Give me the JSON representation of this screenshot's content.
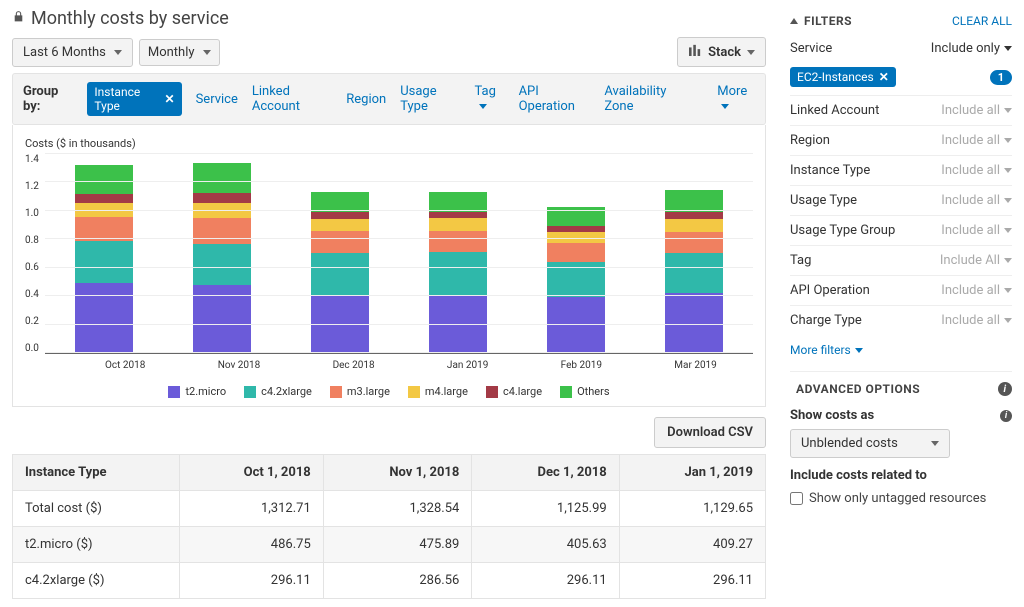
{
  "header": {
    "title": "Monthly costs by service"
  },
  "toolbar": {
    "range_label": "Last 6 Months",
    "granularity_label": "Monthly",
    "stack_label": "Stack"
  },
  "groupby": {
    "label": "Group by:",
    "chip": "Instance Type",
    "options": [
      "Service",
      "Linked Account",
      "Region",
      "Usage Type",
      "Tag",
      "API Operation",
      "Availability Zone",
      "More"
    ]
  },
  "chart_data": {
    "type": "bar",
    "title": "",
    "ylabel": "Costs ($ in thousands)",
    "ylim": [
      0,
      1.4
    ],
    "yticks": [
      "0.0",
      "0.2",
      "0.4",
      "0.6",
      "0.8",
      "1.0",
      "1.2",
      "1.4"
    ],
    "categories": [
      "Oct 2018",
      "Nov 2018",
      "Dec 2018",
      "Jan 2019",
      "Feb 2019",
      "Mar 2019"
    ],
    "series": [
      {
        "name": "t2.micro",
        "color": "#6b5bd9",
        "values": [
          486.75,
          475.89,
          405.63,
          409.27,
          390.0,
          420.0
        ]
      },
      {
        "name": "c4.2xlarge",
        "color": "#2fb8aa",
        "values": [
          296.11,
          286.56,
          296.11,
          296.11,
          250.0,
          280.0
        ]
      },
      {
        "name": "m3.large",
        "color": "#f08060",
        "values": [
          170.0,
          180.0,
          150.0,
          150.0,
          130.0,
          150.0
        ]
      },
      {
        "name": "m4.large",
        "color": "#f3c844",
        "values": [
          100.0,
          110.0,
          90.0,
          90.0,
          80.0,
          90.0
        ]
      },
      {
        "name": "c4.large",
        "color": "#a33a46",
        "values": [
          60.0,
          66.0,
          44.0,
          44.0,
          40.0,
          50.0
        ]
      },
      {
        "name": "Others",
        "color": "#3cc14a",
        "values": [
          200.0,
          210.0,
          140.0,
          140.0,
          130.0,
          150.0
        ]
      }
    ]
  },
  "download_label": "Download CSV",
  "table": {
    "header_main": "Instance Type",
    "columns": [
      "Oct 1, 2018",
      "Nov 1, 2018",
      "Dec 1, 2018",
      "Jan 1, 2019"
    ],
    "rows": [
      {
        "label": "Total cost ($)",
        "values": [
          "1,312.71",
          "1,328.54",
          "1,125.99",
          "1,129.65"
        ]
      },
      {
        "label": "t2.micro ($)",
        "values": [
          "486.75",
          "475.89",
          "405.63",
          "409.27"
        ]
      },
      {
        "label": "c4.2xlarge ($)",
        "values": [
          "296.11",
          "286.56",
          "296.11",
          "296.11"
        ]
      }
    ]
  },
  "filters": {
    "title": "FILTERS",
    "clear_all": "CLEAR ALL",
    "chip": "EC2-Instances",
    "chip_count": "1",
    "rows": [
      {
        "label": "Service",
        "value": "Include only",
        "active": true
      },
      {
        "label": "Linked Account",
        "value": "Include all",
        "active": false
      },
      {
        "label": "Region",
        "value": "Include all",
        "active": false
      },
      {
        "label": "Instance Type",
        "value": "Include all",
        "active": false
      },
      {
        "label": "Usage Type",
        "value": "Include all",
        "active": false
      },
      {
        "label": "Usage Type Group",
        "value": "Include all",
        "active": false
      },
      {
        "label": "Tag",
        "value": "Include All",
        "active": false
      },
      {
        "label": "API Operation",
        "value": "Include all",
        "active": false
      },
      {
        "label": "Charge Type",
        "value": "Include all",
        "active": false
      }
    ],
    "more": "More filters"
  },
  "advanced": {
    "title": "ADVANCED OPTIONS",
    "show_costs_label": "Show costs as",
    "show_costs_value": "Unblended costs",
    "include_label": "Include costs related to",
    "checkbox_label": "Show only untagged resources"
  }
}
